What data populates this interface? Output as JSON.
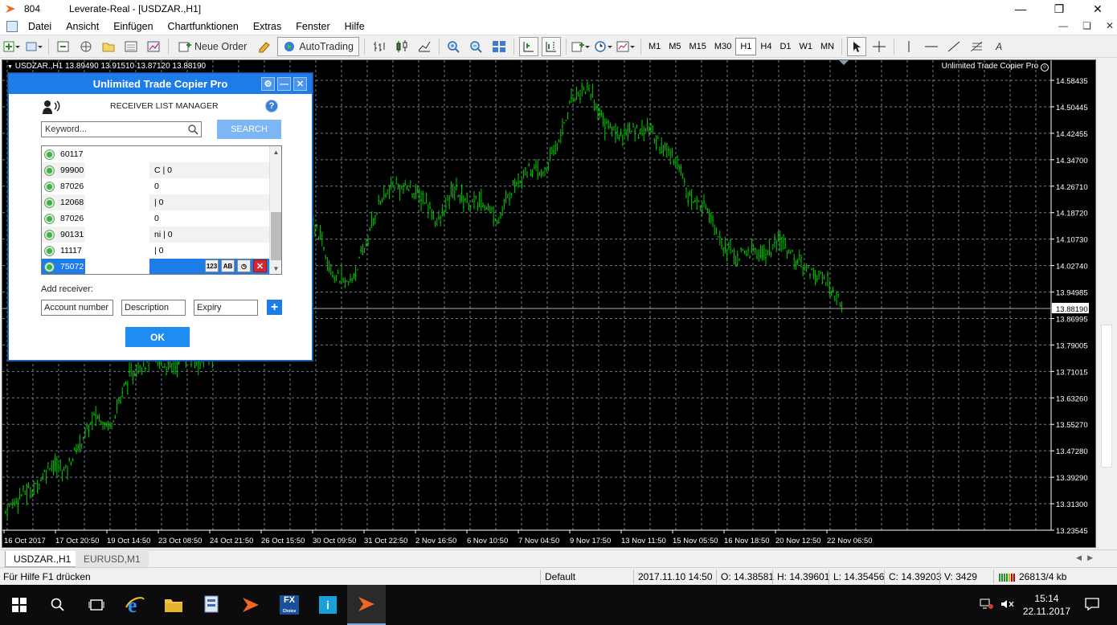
{
  "titlebar": {
    "number": "804",
    "title": "Leverate-Real - [USDZAR.,H1]"
  },
  "menu": [
    "Datei",
    "Ansicht",
    "Einfügen",
    "Chartfunktionen",
    "Extras",
    "Fenster",
    "Hilfe"
  ],
  "toolbar": {
    "new_order": "Neue Order",
    "autotrading": "AutoTrading",
    "periods": [
      "M1",
      "M5",
      "M15",
      "M30",
      "H1",
      "H4",
      "D1",
      "W1",
      "MN"
    ],
    "active_period": "H1"
  },
  "chart": {
    "symbol_header": "USDZAR.,H1  13.89490 13.91510 13.87120 13.88190",
    "ea_name": "Unlimited Trade Copier Pro",
    "bid": "13.88190",
    "colors": {
      "background": "#000000",
      "bars": "#00c800",
      "grid": "#6f7f8f",
      "axis_text": "#ffffff"
    }
  },
  "chart_data": {
    "type": "bar",
    "symbol": "USDZAR.",
    "timeframe": "H1",
    "ylim": [
      13.23545,
      14.58435
    ],
    "y_ticks": [
      "14.58435",
      "14.50445",
      "14.42455",
      "14.34700",
      "14.26710",
      "14.18720",
      "14.10730",
      "14.02740",
      "13.94985",
      "13.86995",
      "13.79005",
      "13.71015",
      "13.63260",
      "13.55270",
      "13.47280",
      "13.39290",
      "13.31300",
      "13.23545"
    ],
    "x_ticks": [
      "16 Oct 2017",
      "17 Oct 20:50",
      "19 Oct 14:50",
      "23 Oct 08:50",
      "24 Oct 21:50",
      "26 Oct 15:50",
      "30 Oct 09:50",
      "31 Oct 22:50",
      "2 Nov 16:50",
      "6 Nov 10:50",
      "7 Nov 04:50",
      "9 Nov 17:50",
      "13 Nov 11:50",
      "15 Nov 05:50",
      "16 Nov 18:50",
      "20 Nov 12:50",
      "22 Nov 06:50"
    ],
    "price_path": [
      13.29,
      13.34,
      13.36,
      13.43,
      13.41,
      13.49,
      13.57,
      13.54,
      13.66,
      13.72,
      13.73,
      13.71,
      13.74,
      13.73,
      13.75,
      14.08,
      14.05,
      14.13,
      14.17,
      14.13,
      14.15,
      14.1,
      13.98,
      13.95,
      14.05,
      14.19,
      14.24,
      14.23,
      14.2,
      14.13,
      14.23,
      14.19,
      14.19,
      14.14,
      14.24,
      14.29,
      14.27,
      14.37,
      14.5,
      14.53,
      14.43,
      14.39,
      14.4,
      14.41,
      14.35,
      14.31,
      14.19,
      14.18,
      14.07,
      14.03,
      14.05,
      14.04,
      14.08,
      14.02,
      13.99,
      13.96,
      13.89
    ],
    "last": 13.8819
  },
  "dialog": {
    "title": "Unlimited Trade Copier Pro",
    "heading": "RECEIVER LIST MANAGER",
    "keyword_placeholder": "Keyword...",
    "search_label": "SEARCH",
    "rows": [
      {
        "acct": "60117",
        "desc": ""
      },
      {
        "acct": "99900",
        "desc": "C | 0"
      },
      {
        "acct": "87026",
        "desc": "0"
      },
      {
        "acct": "12068",
        "desc": "| 0"
      },
      {
        "acct": "87026",
        "desc": "0"
      },
      {
        "acct": "90131",
        "desc": "ni | 0"
      },
      {
        "acct": "11117",
        "desc": "| 0"
      },
      {
        "acct": "75072",
        "desc": ""
      }
    ],
    "row_icons": [
      "123",
      "AB"
    ],
    "add_receiver": "Add receiver:",
    "fields": {
      "account": "Account number",
      "description": "Description",
      "expiry": "Expiry"
    },
    "ok": "OK"
  },
  "tabs": [
    "USDZAR.,H1",
    "EURUSD,M1"
  ],
  "status": {
    "help": "Für Hilfe F1 drücken",
    "profile": "Default",
    "datetime": "2017.11.10 14:50",
    "open": "O: 14.38581",
    "high": "H: 14.39601",
    "low": "L: 14.35456",
    "close": "C: 14.39203",
    "volume": "V: 3429",
    "traffic": "26813/4 kb"
  },
  "taskbar": {
    "time": "15:14",
    "date": "22.11.2017"
  }
}
